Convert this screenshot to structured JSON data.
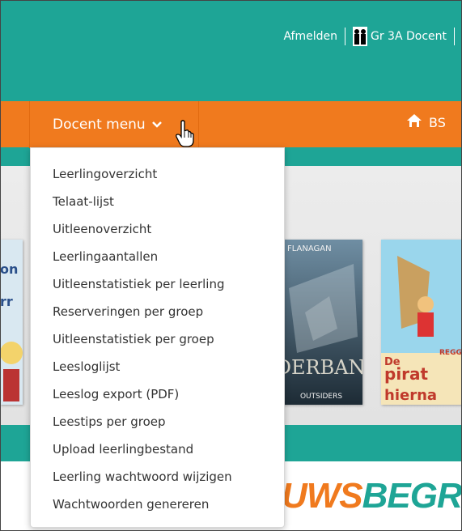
{
  "header": {
    "logout_label": "Afmelden",
    "user_label": "Gr 3A Docent"
  },
  "nav": {
    "menu_label": "Docent menu",
    "home_label": "BS"
  },
  "dropdown": {
    "items": [
      "Leerlingoverzicht",
      "Telaat-lijst",
      "Uitleenoverzicht",
      "Leerlingaantallen",
      "Uitleenstatistiek per leerling",
      "Reserveringen per groep",
      "Uitleenstatistiek per groep",
      "Leesloglijst",
      "Leeslog export (PDF)",
      "Leestips per groep",
      "Upload leerlingbestand",
      "Leerling wachtwoord wijzigen",
      "Wachtwoorden genereren"
    ]
  },
  "books": [
    {
      "title": "FLANAGAN",
      "subtitle": "EDERBAND",
      "footer": "OUTSIDERS"
    },
    {
      "title": "De pirate van hierna",
      "badge": "REGGI"
    }
  ],
  "footer": {
    "logo_text": "UWSBEGR!"
  },
  "colors": {
    "teal": "#1ea596",
    "orange": "#f07a1e"
  }
}
